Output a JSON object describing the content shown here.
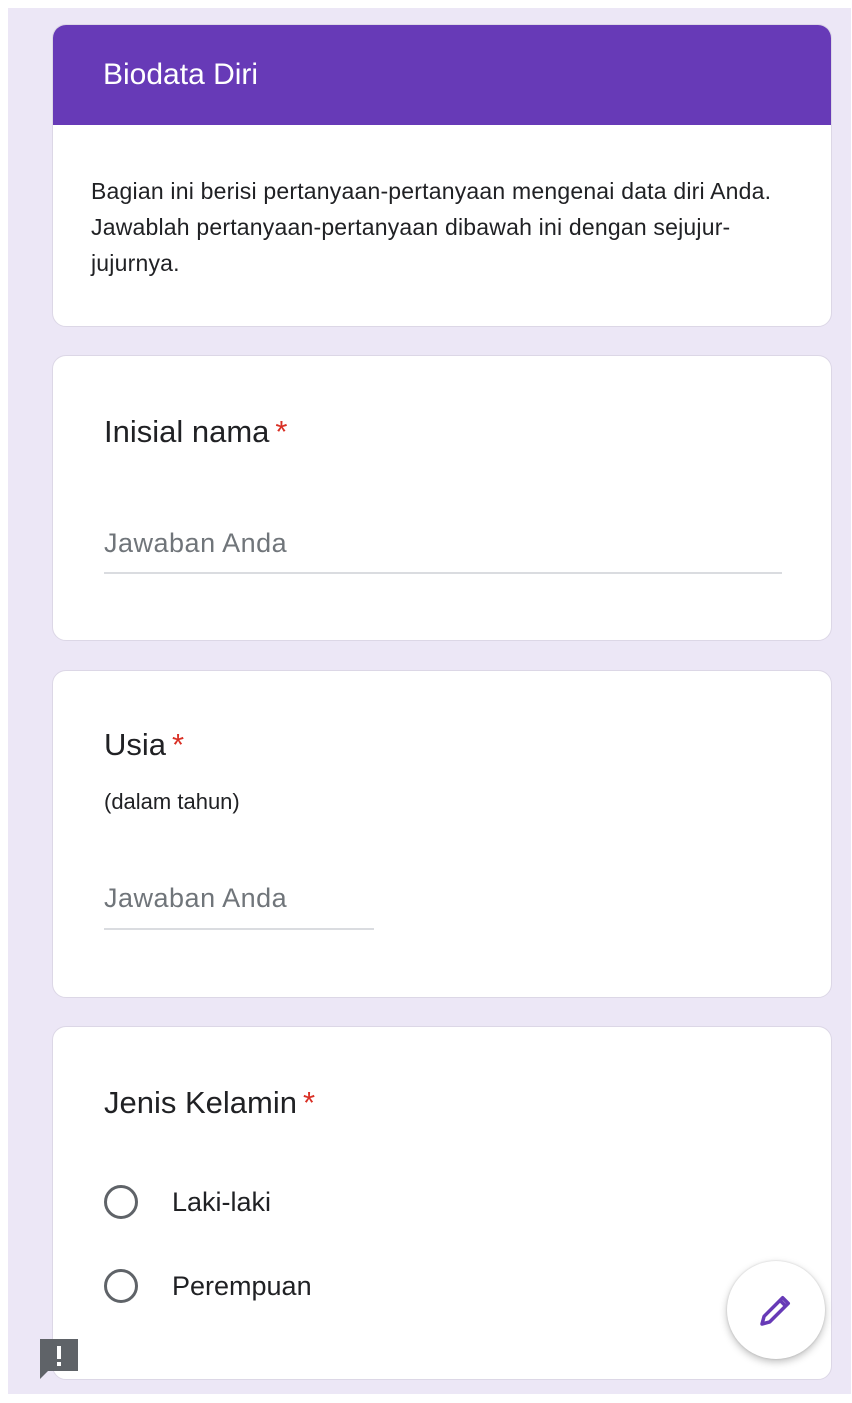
{
  "section": {
    "title": "Biodata Diri",
    "description": "Bagian ini berisi pertanyaan-pertanyaan mengenai data diri Anda. Jawablah pertanyaan-pertanyaan dibawah ini dengan sejujur-jujurnya."
  },
  "questions": [
    {
      "title": "Inisial nama",
      "required_mark": "*",
      "placeholder": "Jawaban Anda"
    },
    {
      "title": "Usia",
      "required_mark": "*",
      "subtitle": "(dalam tahun)",
      "placeholder": "Jawaban Anda"
    },
    {
      "title": "Jenis Kelamin",
      "required_mark": "*",
      "options": [
        "Laki-laki",
        "Perempuan"
      ]
    }
  ],
  "icons": {
    "fab": "pencil-icon",
    "report": "report-problem-icon"
  },
  "colors": {
    "accent": "#673ab7",
    "required": "#d93025",
    "background": "#ece7f6"
  }
}
